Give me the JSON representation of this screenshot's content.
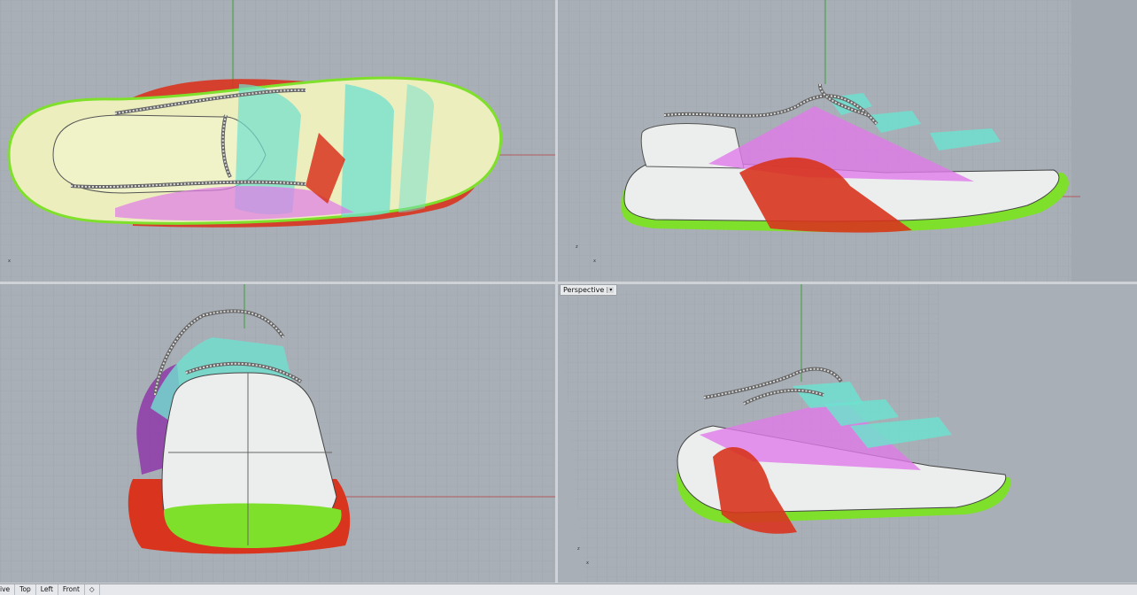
{
  "viewports": {
    "perspective_title": "Perspective",
    "perspective_dropdown": "▾"
  },
  "tabs": [
    "ive",
    "Top",
    "Left",
    "Front",
    "◇"
  ],
  "axes": {
    "x": "x",
    "y": "y",
    "z": "z"
  },
  "colors": {
    "viewport_bg": "#a9afb6",
    "grid_line": "#9ba2a9",
    "sole_green": "#7ee02a",
    "upper_cyan": "#6fe0cf",
    "upper_magenta": "#e07ae8",
    "heel_red": "#d8341e",
    "shell_white": "#e8eaea"
  }
}
